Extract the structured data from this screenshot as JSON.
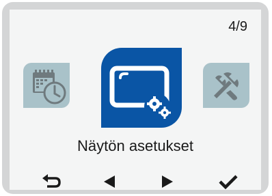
{
  "header": {
    "page_counter": "4/9"
  },
  "menu": {
    "items": [
      {
        "icon": "calendar-clock-icon",
        "selected": false
      },
      {
        "icon": "display-settings-icon",
        "selected": true,
        "label": "Näytön asetukset"
      },
      {
        "icon": "tools-icon",
        "selected": false
      }
    ],
    "selected_label": "Näytön asetukset"
  },
  "nav": {
    "buttons": [
      "back-arrow-icon",
      "previous-triangle-icon",
      "next-triangle-icon",
      "confirm-check-icon"
    ]
  },
  "colors": {
    "selected_tile": "#0a55a5",
    "inactive_tile": "#a9c2c9",
    "inactive_icon": "#6f7a7e",
    "text": "#1a1a1a",
    "screen_bg": "#f4f5f5",
    "bezel": "#d4d5d6"
  }
}
